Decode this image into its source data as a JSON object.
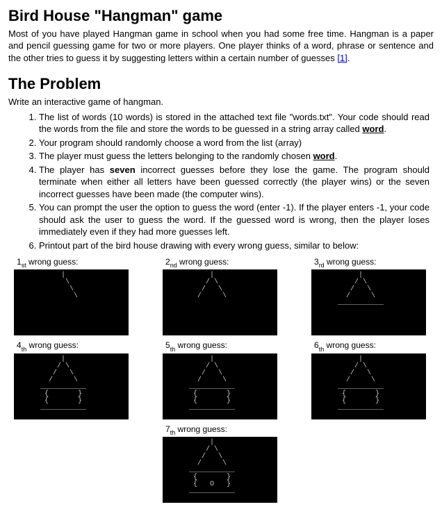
{
  "title": "Bird House \"Hangman\" game",
  "intro": "Most of you have played Hangman game in school when you had some free time. Hangman is a paper and pencil guessing game for two or more players. One player thinks of a word, phrase or sentence and the other tries to guess it by suggesting letters within a certain number of guesses ",
  "ref": "[1]",
  "problem_heading": "The Problem",
  "problem_sub": "Write an interactive game of hangman.",
  "items": [
    {
      "pre": "The list of words (10 words) is stored in the attached text file \"words.txt\". Your code should read the words from the file and store the words to be guessed in a string array called ",
      "bold_u": "word",
      "post": "."
    },
    {
      "pre": "Your program should randomly choose a word from the list (array)"
    },
    {
      "pre": "The player must guess the letters belonging to the randomly chosen ",
      "bold_u": "word",
      "post": "."
    },
    {
      "pre": "The player has ",
      "bold": "seven",
      "post": " incorrect guesses before they lose the game. The program should terminate when either all letters have been guessed correctly (the player wins) or the seven incorrect guesses have been made (the computer wins)."
    },
    {
      "pre": "You can prompt the user the option to guess the word (enter -1). If the player enters -1, your code should ask the user to guess the word. If the guessed word is wrong, then the player loses immediately even if they had more guesses left."
    },
    {
      "pre": "Printout part of the bird house drawing with every wrong guess, similar to below:"
    }
  ],
  "figs": [
    {
      "n": "1",
      "suffix": "st",
      "label": " wrong guess:",
      "art": "           |\n            \\\n             \\\n              \\\n"
    },
    {
      "n": "2",
      "suffix": "nd",
      "label": " wrong guess:",
      "art": "           |\n          / \\\n         /   \\\n        /     \\\n"
    },
    {
      "n": "3",
      "suffix": "rd",
      "label": " wrong guess:",
      "art": "           |\n          / \\\n         /   \\\n        /     \\\n      ___________\n"
    },
    {
      "n": "4",
      "suffix": "th",
      "label": " wrong guess:",
      "art": "           |\n          / \\\n         /   \\\n        /     \\\n      ___________\n       {       }\n       {       }\n      ___________"
    },
    {
      "n": "5",
      "suffix": "th",
      "label": " wrong guess:",
      "art": "           |\n          / \\\n         /   \\\n        /     \\\n      ___________\n       {       }\n       {       }\n      ___________"
    },
    {
      "n": "6",
      "suffix": "th",
      "label": " wrong guess:",
      "art": "           |\n          / \\\n         /   \\\n        /     \\\n      ___________\n       {       }\n       {       }\n      ___________"
    },
    {
      "n": "7",
      "suffix": "th",
      "label": " wrong guess:",
      "art": "           |\n          / \\\n         /   \\\n        /     \\\n      ___________\n       {       }\n       {   O   }\n      ___________"
    }
  ]
}
